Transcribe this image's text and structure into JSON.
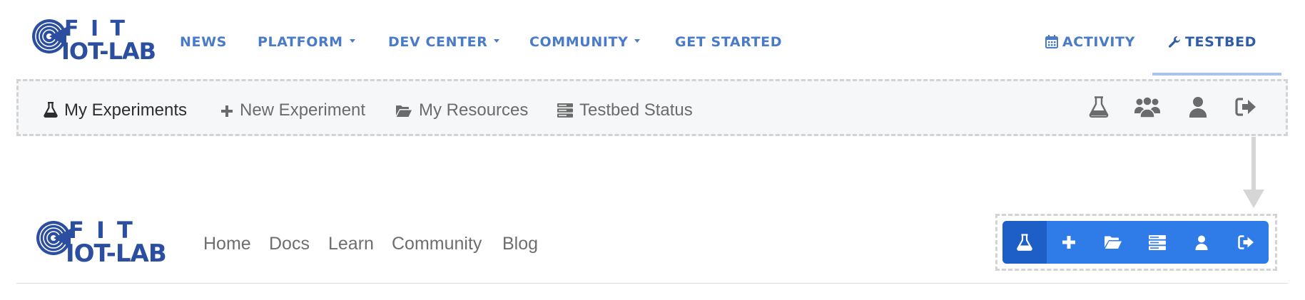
{
  "logo": {
    "line1": "F I T",
    "line2": "IOT-LAB"
  },
  "top_nav": {
    "news": "NEWS",
    "platform": "PLATFORM",
    "dev_center": "DEV CENTER",
    "community": "COMMUNITY",
    "get_started": "GET STARTED",
    "activity": "ACTIVITY",
    "testbed": "TESTBED"
  },
  "subbar": {
    "my_experiments": "My Experiments",
    "new_experiment": "New Experiment",
    "my_resources": "My Resources",
    "testbed_status": "Testbed Status",
    "icons": [
      "flask-icon",
      "users-icon",
      "user-icon",
      "sign-out-icon"
    ]
  },
  "bottom_nav": {
    "home": "Home",
    "docs": "Docs",
    "learn": "Learn",
    "community": "Community",
    "blog": "Blog"
  },
  "compact_toolbar": {
    "icons": [
      "flask-icon",
      "plus-icon",
      "folder-open-icon",
      "server-icon",
      "user-icon",
      "sign-out-icon"
    ],
    "active": "flask-icon"
  },
  "colors": {
    "brand": "#2b4ea0",
    "nav_link": "#4a7bc8",
    "active_underline": "#a9c4ea",
    "toolbar_blue": "#2f7be8",
    "toolbar_active": "#1e5fc7",
    "subbar_bg": "#f6f7f9"
  }
}
